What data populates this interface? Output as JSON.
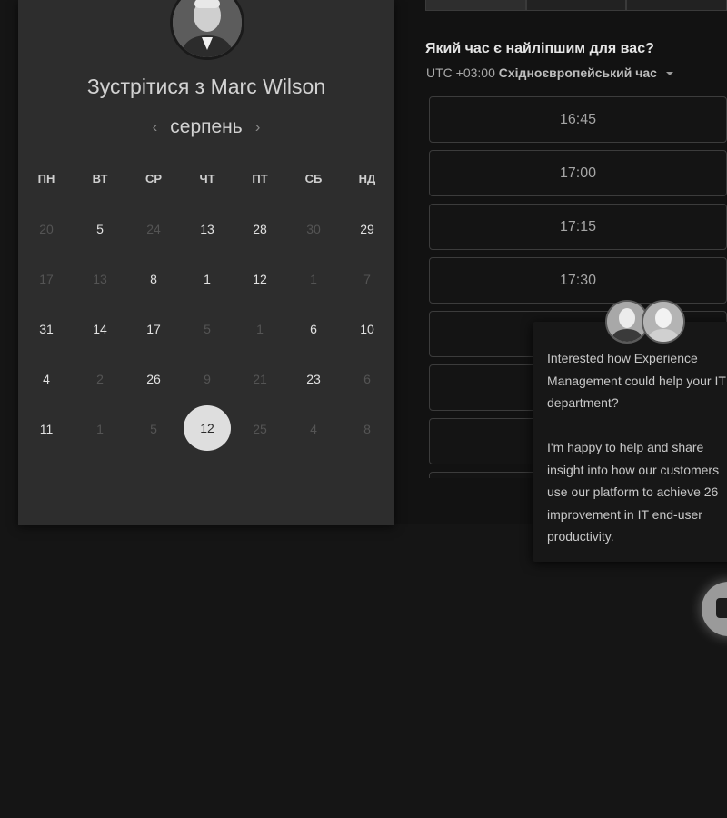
{
  "scheduler": {
    "title": "Зустрітися з Marc Wilson",
    "month": "серпень",
    "prev_icon": "chevron-left-icon",
    "next_icon": "chevron-right-icon",
    "weekdays": [
      "ПН",
      "ВТ",
      "СР",
      "ЧТ",
      "ПТ",
      "СБ",
      "НД"
    ],
    "weeks": [
      [
        {
          "d": "20",
          "active": false
        },
        {
          "d": "5",
          "active": true
        },
        {
          "d": "24",
          "active": false
        },
        {
          "d": "13",
          "active": true
        },
        {
          "d": "28",
          "active": true
        },
        {
          "d": "30",
          "active": false
        },
        {
          "d": "29",
          "active": true
        }
      ],
      [
        {
          "d": "17",
          "active": false
        },
        {
          "d": "13",
          "active": false
        },
        {
          "d": "8",
          "active": true
        },
        {
          "d": "1",
          "active": true
        },
        {
          "d": "12",
          "active": true
        },
        {
          "d": "1",
          "active": false
        },
        {
          "d": "7",
          "active": false
        }
      ],
      [
        {
          "d": "31",
          "active": true
        },
        {
          "d": "14",
          "active": true
        },
        {
          "d": "17",
          "active": true
        },
        {
          "d": "5",
          "active": false
        },
        {
          "d": "1",
          "active": false
        },
        {
          "d": "6",
          "active": true
        },
        {
          "d": "10",
          "active": true
        }
      ],
      [
        {
          "d": "4",
          "active": true
        },
        {
          "d": "2",
          "active": false
        },
        {
          "d": "26",
          "active": true
        },
        {
          "d": "9",
          "active": false
        },
        {
          "d": "21",
          "active": false
        },
        {
          "d": "23",
          "active": true
        },
        {
          "d": "6",
          "active": false
        }
      ],
      [
        {
          "d": "11",
          "active": true
        },
        {
          "d": "1",
          "active": false
        },
        {
          "d": "5",
          "active": false
        },
        {
          "d": "12",
          "active": true,
          "selected": true
        },
        {
          "d": "25",
          "active": false
        },
        {
          "d": "4",
          "active": false
        },
        {
          "d": "8",
          "active": false
        }
      ]
    ]
  },
  "time_picker": {
    "question": "Який час є найліпшим для вас?",
    "tz_offset": "UTC +03:00",
    "tz_name": "Східноєвропейський час",
    "slots": [
      "16:45",
      "17:00",
      "17:15",
      "17:30",
      "",
      "",
      "",
      ""
    ]
  },
  "chat": {
    "lines": [
      "Interested how Experience",
      "Management could help your IT",
      "department?",
      "",
      "I'm happy to help and share",
      "insight into how our customers",
      "use our platform to achieve 26",
      "improvement in IT end-user",
      "productivity."
    ]
  },
  "colors": {
    "card_bg": "#2d2d2d",
    "selected_day_bg": "#dedede",
    "page_bg": "#151515"
  }
}
